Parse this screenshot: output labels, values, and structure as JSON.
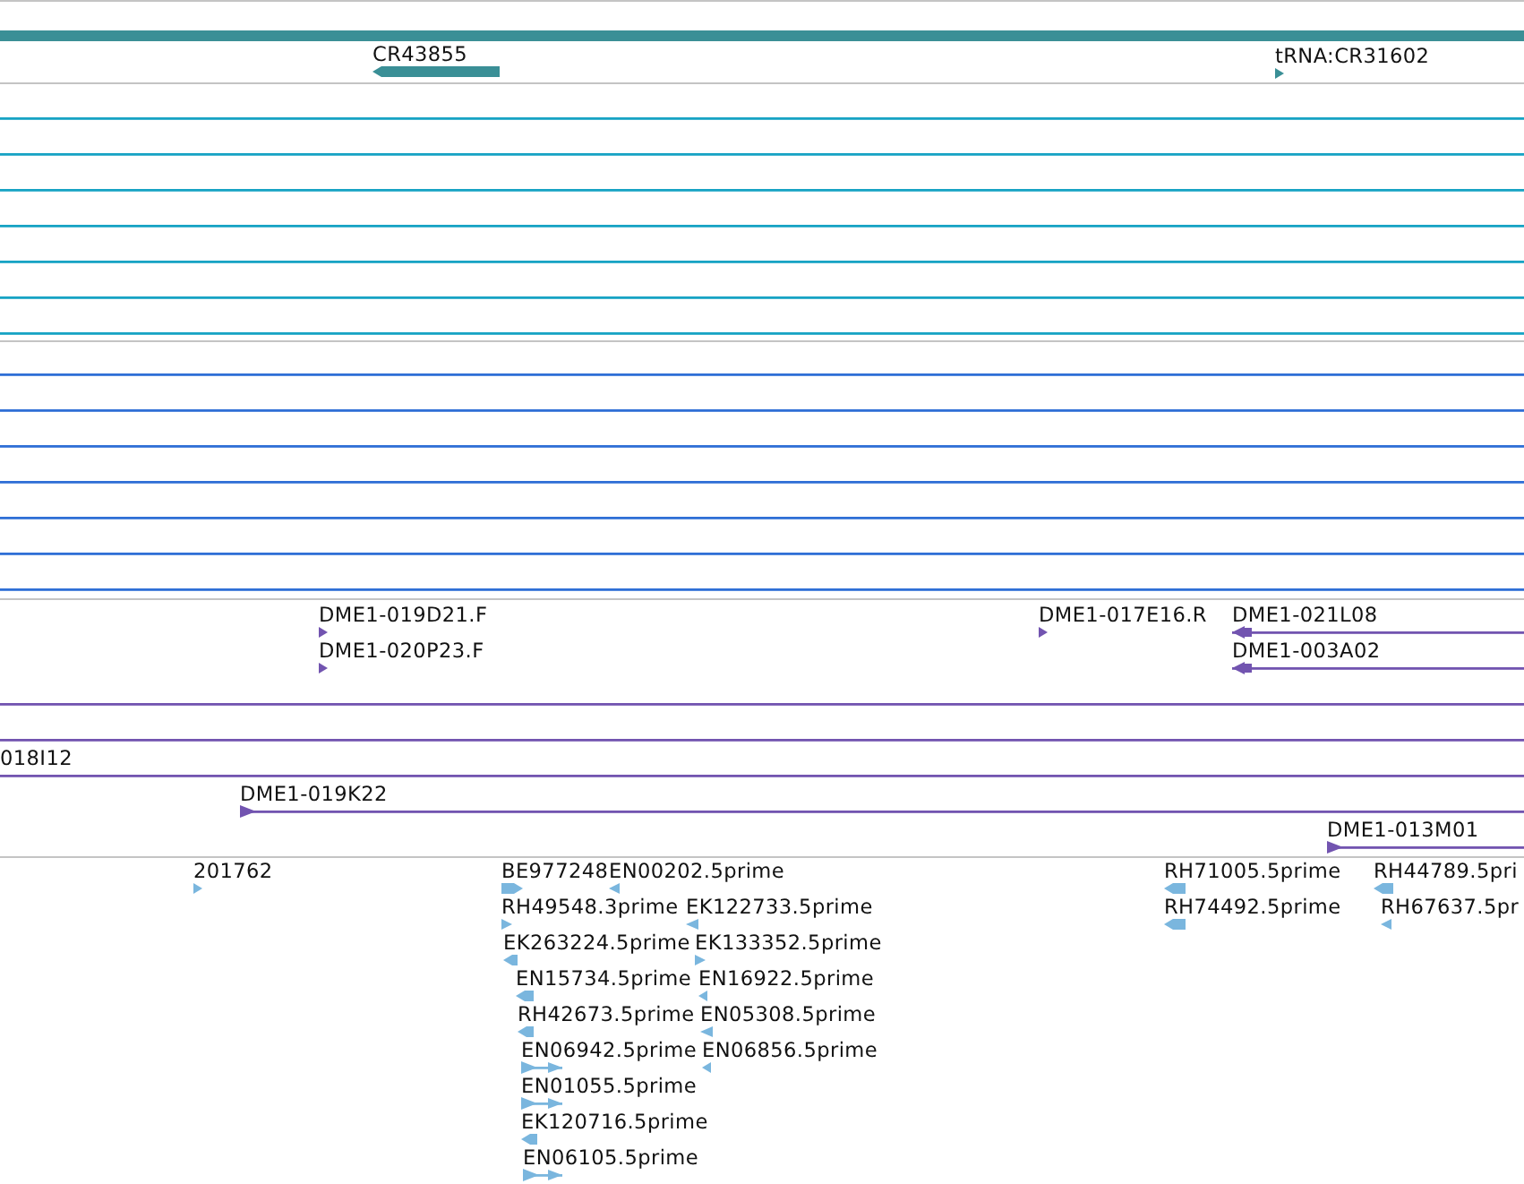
{
  "tracks": [
    {
      "color": "#3a8f96",
      "features": [
        {
          "kind": "plainbar"
        },
        {
          "label": "CR43855",
          "kind": "leftbar"
        },
        {
          "label": "tRNA:CR31602",
          "kind": "righttick"
        }
      ]
    },
    {
      "color": "#17a3c4",
      "features": [
        {
          "kind": "plainline"
        },
        {
          "kind": "plainline"
        },
        {
          "kind": "plainline"
        },
        {
          "kind": "plainline"
        },
        {
          "kind": "plainline"
        },
        {
          "kind": "plainline"
        },
        {
          "kind": "plainline"
        }
      ]
    },
    {
      "color": "#2f6fd6",
      "features": [
        {
          "kind": "plainline"
        },
        {
          "kind": "plainline"
        },
        {
          "kind": "plainline"
        },
        {
          "kind": "plainline"
        },
        {
          "kind": "plainline"
        },
        {
          "kind": "plainline"
        },
        {
          "kind": "plainline"
        }
      ]
    },
    {
      "color": "#7254b0",
      "features": [
        {
          "label": "DME1-019D21.F",
          "kind": "righttick"
        },
        {
          "label": "DME1-017E16.R",
          "kind": "righttick"
        },
        {
          "label": "DME1-021L08",
          "kind": "leftline"
        },
        {
          "label": "DME1-020P23.F",
          "kind": "righttick"
        },
        {
          "label": "DME1-003A02",
          "kind": "leftline"
        },
        {
          "kind": "plainline"
        },
        {
          "kind": "plainline"
        },
        {
          "label": "018I12",
          "kind": "plainline"
        },
        {
          "label": "DME1-019K22",
          "kind": "rightline"
        },
        {
          "label": "DME1-013M01",
          "kind": "rightline"
        }
      ]
    },
    {
      "color": "#7ab6de",
      "features": [
        {
          "label": "201762",
          "kind": "righttick"
        },
        {
          "label": "BE977248",
          "kind": "rightbar"
        },
        {
          "label": "EN00202.5prime",
          "kind": "lefttick"
        },
        {
          "label": "RH71005.5prime",
          "kind": "leftbar"
        },
        {
          "label": "RH44789.5pri",
          "kind": "leftbar"
        },
        {
          "label": "RH49548.3prime",
          "kind": "righttick"
        },
        {
          "label": "EK122733.5prime",
          "kind": "lefttick"
        },
        {
          "label": "RH74492.5prime",
          "kind": "leftbar"
        },
        {
          "label": "RH67637.5pr",
          "kind": "lefttick"
        },
        {
          "label": "EK263224.5prime",
          "kind": "leftbar"
        },
        {
          "label": "EK133352.5prime",
          "kind": "righttick"
        },
        {
          "label": "EN15734.5prime",
          "kind": "leftbar"
        },
        {
          "label": "EN16922.5prime",
          "kind": "lefttick"
        },
        {
          "label": "RH42673.5prime",
          "kind": "leftbar"
        },
        {
          "label": "EN05308.5prime",
          "kind": "lefttick"
        },
        {
          "label": "EN06942.5prime",
          "kind": "rightline"
        },
        {
          "label": "EN06856.5prime",
          "kind": "lefttick"
        },
        {
          "label": "EN01055.5prime",
          "kind": "rightline"
        },
        {
          "label": "EK120716.5prime",
          "kind": "leftbar"
        },
        {
          "label": "EN06105.5prime",
          "kind": "rightline"
        }
      ]
    }
  ]
}
